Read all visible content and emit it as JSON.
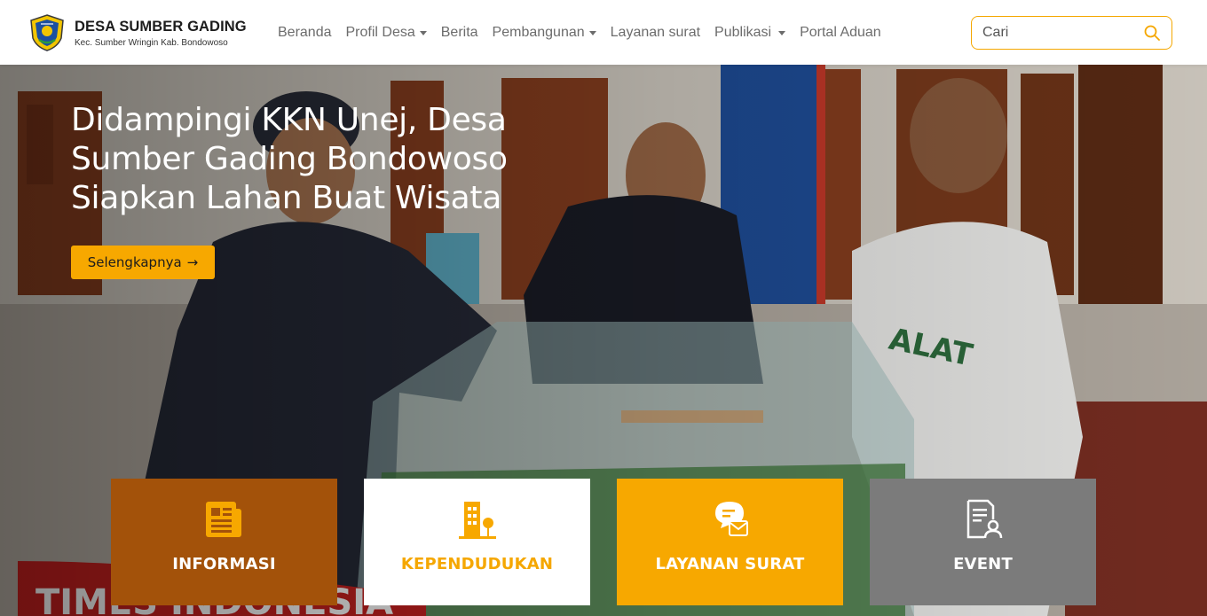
{
  "brand": {
    "title": "DESA SUMBER GADING",
    "subtitle": "Kec. Sumber Wringin Kab. Bondowoso"
  },
  "nav": {
    "items": [
      {
        "label": "Beranda",
        "dropdown": false
      },
      {
        "label": "Profil Desa",
        "dropdown": true
      },
      {
        "label": "Berita",
        "dropdown": false
      },
      {
        "label": "Pembangunan",
        "dropdown": true
      },
      {
        "label": "Layanan surat",
        "dropdown": false
      },
      {
        "label": "Publikasi",
        "dropdown": true
      },
      {
        "label": "Portal Aduan",
        "dropdown": false
      }
    ]
  },
  "search": {
    "placeholder": "Cari",
    "icon": "search-icon"
  },
  "hero": {
    "title": "Didampingi KKN Unej, Desa Sumber Gading Bondowoso Siapkan Lahan Buat Wisata",
    "button_label": "Selengkapnya",
    "button_icon": "arrow-right-icon"
  },
  "cards": [
    {
      "label": "INFORMASI",
      "icon": "newspaper-icon"
    },
    {
      "label": "KEPENDUDUKAN",
      "icon": "building-tree-icon"
    },
    {
      "label": "LAYANAN SURAT",
      "icon": "chat-mail-icon"
    },
    {
      "label": "EVENT",
      "icon": "document-user-icon"
    }
  ],
  "colors": {
    "accent": "#f7a800",
    "informasi_bg": "#a3520a",
    "event_bg": "#7b7b7b"
  }
}
